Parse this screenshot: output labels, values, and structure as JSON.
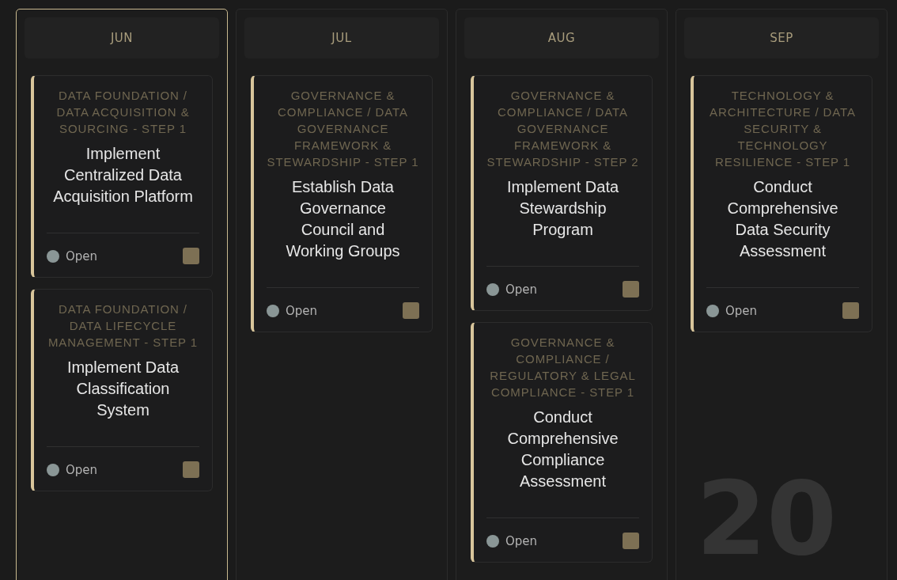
{
  "backdrop_year": "20",
  "columns": [
    {
      "month": "JUN",
      "selected": true,
      "cards": [
        {
          "category": "DATA FOUNDATION / DATA ACQUISITION & SOURCING - STEP 1",
          "title": "Implement Centralized Data Acquisition Platform",
          "status": "Open",
          "checked": false
        },
        {
          "category": "DATA FOUNDATION / DATA LIFECYCLE MANAGEMENT - STEP 1",
          "title": "Implement Data Classification System",
          "status": "Open",
          "checked": false
        }
      ]
    },
    {
      "month": "JUL",
      "selected": false,
      "cards": [
        {
          "category": "GOVERNANCE & COMPLIANCE / DATA GOVERNANCE FRAMEWORK & STEWARDSHIP - STEP 1",
          "title": "Establish Data Governance Council and Working Groups",
          "status": "Open",
          "checked": false
        }
      ]
    },
    {
      "month": "AUG",
      "selected": false,
      "cards": [
        {
          "category": "GOVERNANCE & COMPLIANCE / DATA GOVERNANCE FRAMEWORK & STEWARDSHIP - STEP 2",
          "title": "Implement Data Stewardship Program",
          "status": "Open",
          "checked": false
        },
        {
          "category": "GOVERNANCE & COMPLIANCE / REGULATORY & LEGAL COMPLIANCE - STEP 1",
          "title": "Conduct Comprehensive Compliance Assessment",
          "status": "Open",
          "checked": false
        }
      ]
    },
    {
      "month": "SEP",
      "selected": false,
      "cards": [
        {
          "category": "TECHNOLOGY & ARCHITECTURE / DATA SECURITY & TECHNOLOGY RESILIENCE - STEP 1",
          "title": "Conduct Comprehensive Data Security Assessment",
          "status": "Open",
          "checked": false
        }
      ]
    }
  ]
}
